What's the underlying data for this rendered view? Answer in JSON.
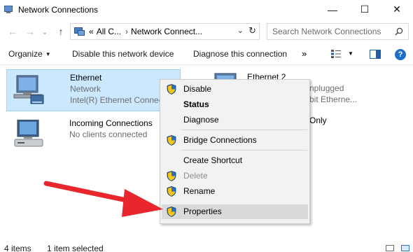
{
  "window": {
    "title": "Network Connections",
    "minimize_glyph": "—",
    "maximize_glyph": "☐",
    "close_glyph": "✕"
  },
  "nav": {
    "back_glyph": "←",
    "forward_glyph": "→",
    "recent_glyph": "⌄",
    "up_glyph": "↑",
    "breadcrumb_prefix": "«",
    "breadcrumb": [
      "All C...",
      "Network Connect..."
    ],
    "breadcrumb_separator": "›",
    "refresh_glyph": "↻",
    "dropdown_glyph": "⌄"
  },
  "search": {
    "placeholder": "Search Network Connections"
  },
  "commands": {
    "organize": "Organize",
    "disable": "Disable this network device",
    "diagnose": "Diagnose this connection",
    "more": "»",
    "help": "?"
  },
  "items": [
    {
      "name": "Ethernet",
      "line1": "Network",
      "line2": "Intel(R) Ethernet Connec",
      "selected": true
    },
    {
      "name": "Ethernet 2",
      "line1": "nplugged",
      "line2": "bit Etherne..."
    },
    {
      "name": "Incoming Connections",
      "line1": "No clients connected"
    },
    {
      "line1": "Only"
    }
  ],
  "context_menu": {
    "items": [
      {
        "label": "Disable",
        "shield": true
      },
      {
        "label": "Status",
        "bold": true
      },
      {
        "label": "Diagnose"
      },
      {
        "label": "Bridge Connections",
        "shield": true
      },
      {
        "label": "Create Shortcut"
      },
      {
        "label": "Delete",
        "shield": true,
        "disabled": true
      },
      {
        "label": "Rename",
        "shield": true
      },
      {
        "label": "Properties",
        "shield": true,
        "highlighted": true
      }
    ]
  },
  "status": {
    "count": "4 items",
    "selected": "1 item selected"
  },
  "colors": {
    "selection_bg": "#cce8ff",
    "selection_border": "#99d1ff",
    "menu_bg": "#f2f2f2",
    "arrow": "#e8262b",
    "accent": "#1f6fc6"
  }
}
